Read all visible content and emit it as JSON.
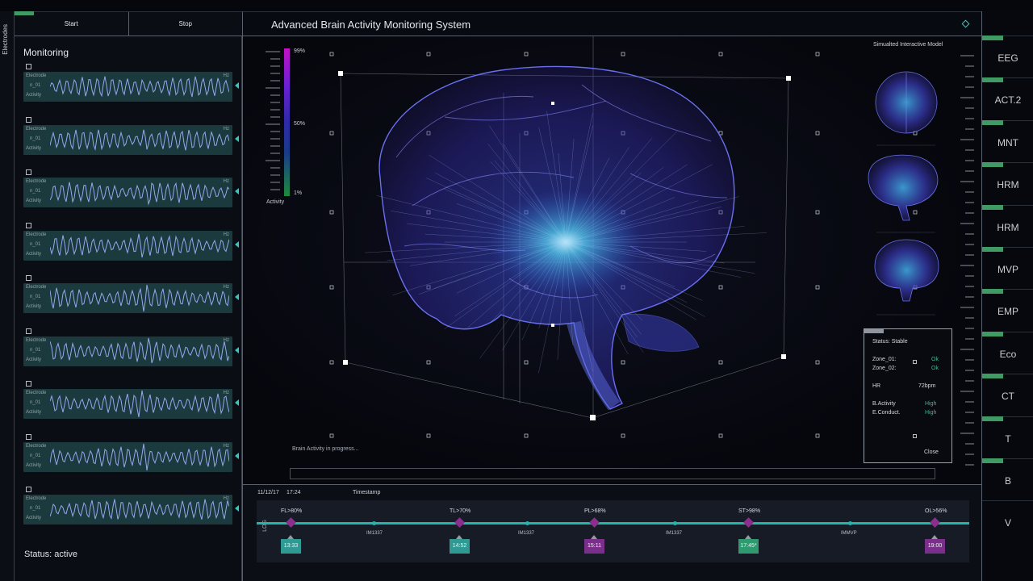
{
  "sidebar_tab": "Electrodes",
  "controls": {
    "start": "Start",
    "stop": "Stop"
  },
  "monitoring": {
    "title": "Monitoring",
    "row_label_top": "Electrode",
    "row_label_id": "n_01",
    "row_label_bottom": "Activity",
    "row_unit": "Hz",
    "row_count": 9,
    "status": "Status: active"
  },
  "header": {
    "title": "Advanced Brain Activity Monitoring System"
  },
  "legend": {
    "max": "99%",
    "mid": "50%",
    "min": "1%",
    "label": "Activity"
  },
  "model": {
    "label": "Simualted Interactive Model"
  },
  "progress": {
    "text": "Brain Activity in progress..."
  },
  "status_panel": {
    "title": "Status: Stable",
    "zone1": "Zone_01:",
    "zone1_val": "Ok",
    "zone2": "Zone_02:",
    "zone2_val": "Ok",
    "hr": "HR",
    "hr_val": "72bpm",
    "bact": "B.Activity",
    "bact_val": "High",
    "econd": "E.Conduct.",
    "econd_val": "High",
    "close": "Close"
  },
  "nav": [
    "EEG",
    "ACT.2",
    "MNT",
    "HRM",
    "HRM",
    "MVP",
    "EMP",
    "Eco",
    "CT",
    "T",
    "B",
    "V"
  ],
  "timeline": {
    "date": "11/12/17",
    "time": "17:24",
    "label": "Timestamp",
    "log": "LOG",
    "events": [
      {
        "label": "FL>80%",
        "time": "13:33",
        "color": "#2f9a93"
      },
      {
        "label": "TL>70%",
        "time": "14:52",
        "color": "#2f9a93"
      },
      {
        "label": "PL>68%",
        "time": "15:11",
        "color": "#7a2f8a"
      },
      {
        "label": "ST>98%",
        "time": "17:45*",
        "color": "#2f9a6f"
      },
      {
        "label": "OL>56%",
        "time": "19:00",
        "color": "#7a2f8a"
      }
    ],
    "mid_labels": [
      "IM1337",
      "IM1337",
      "IM1337",
      "IMMVP"
    ]
  },
  "colors": {
    "accent": "#24b6ad",
    "green_mark": "#3f9a63",
    "wave_bg": "#1a3a3d",
    "wave_line": "#9aa6f0"
  }
}
